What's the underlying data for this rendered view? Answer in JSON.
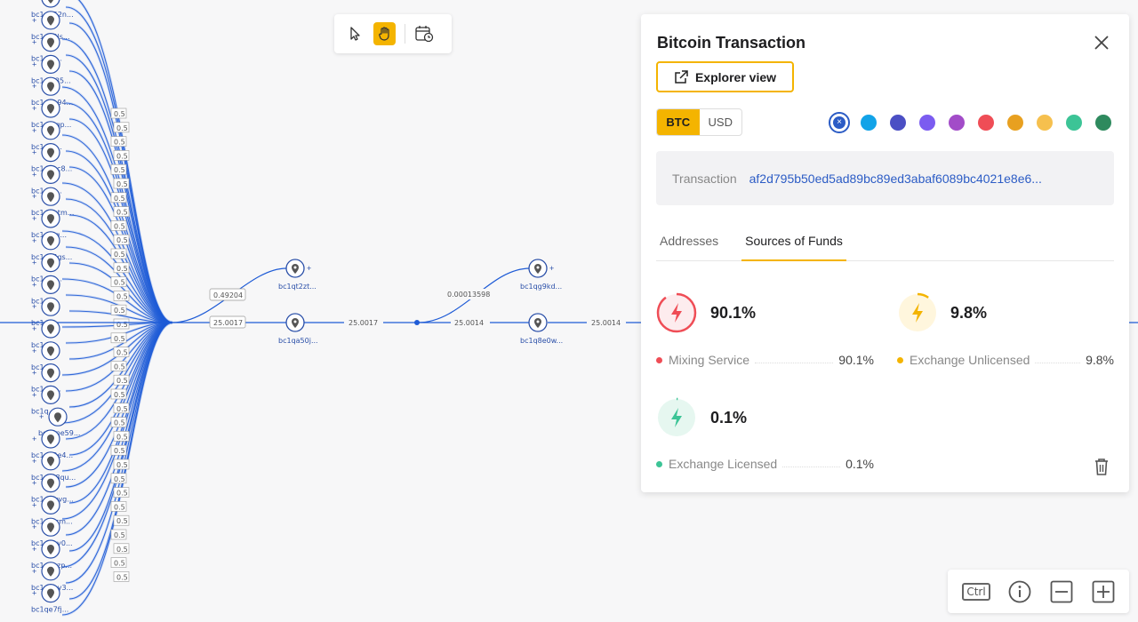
{
  "toolbar": {
    "tools": [
      {
        "name": "select-tool",
        "icon": "cursor-icon"
      },
      {
        "name": "pan-tool",
        "icon": "hand-icon",
        "active": true
      },
      {
        "name": "date-tool",
        "icon": "calendar-clock-icon"
      }
    ]
  },
  "graph": {
    "left_nodes": [
      "bc1q252n...",
      "bc1ae0ls...",
      "bc1...8...",
      "bc1qj935...",
      "bc1ono94...",
      "bc1qrxqp...",
      "bc1...9...",
      "bc1q3cc8...",
      "bc1...a...",
      "bc1q6utm...",
      "bc1...0g...",
      "bc1qv4gs...",
      "bc1...4...",
      "bc1...",
      "bc1...",
      "bc1...",
      "bc1...",
      "bc1qjc...",
      "bc1q...",
      "bc1qpe59...",
      "bc1qx9e4...",
      "bc1qm8qu...",
      "bc1qswvg...",
      "bc1qzzrm...",
      "bc1q2cy0...",
      "bc1q7czp...",
      "bc1q9uy3...",
      "bc1qe7fj..."
    ],
    "left_edge_label": "0.5",
    "middle_nodes": [
      {
        "label": "bc1qt2zt...",
        "edge": "0.49204"
      },
      {
        "label": "bc1qa50j...",
        "edge": "25.0017"
      }
    ],
    "main_edges": [
      "25.0017",
      "25.0014",
      "25.0014"
    ],
    "branch_edge": "0.00013598",
    "right_nodes": [
      "bc1qg9kd...",
      "bc1q8e0w..."
    ]
  },
  "panel": {
    "title": "Bitcoin Transaction",
    "explorer_label": "Explorer view",
    "currency": {
      "options": [
        "BTC",
        "USD"
      ],
      "selected": "BTC"
    },
    "colors": [
      "#2c5cc5",
      "#12a3e8",
      "#4b4fc4",
      "#7b5cf0",
      "#a24cc8",
      "#ef4d56",
      "#e8a020",
      "#f6c04e",
      "#3cc496",
      "#2e8a5e"
    ],
    "selected_color": "#2c5cc5",
    "transaction_label": "Transaction",
    "transaction_hash": "af2d795b50ed5ad89bc89ed3abaf6089bc4021e8e6...",
    "tabs": [
      {
        "label": "Addresses",
        "active": false
      },
      {
        "label": "Sources of Funds",
        "active": true
      }
    ],
    "funds": [
      {
        "name": "Mixing Service",
        "pct": "90.1%",
        "value": 90.1,
        "color": "#ef4d56",
        "bg": "#fdecee"
      },
      {
        "name": "Exchange Unlicensed",
        "pct": "9.8%",
        "value": 9.8,
        "color": "#f4b400",
        "bg": "#fff6dd"
      },
      {
        "name": "Exchange Licensed",
        "pct": "0.1%",
        "value": 0.1,
        "color": "#3cc496",
        "bg": "#e6f7f0"
      }
    ]
  },
  "zoom": {
    "ctrl_label": "Ctrl"
  }
}
